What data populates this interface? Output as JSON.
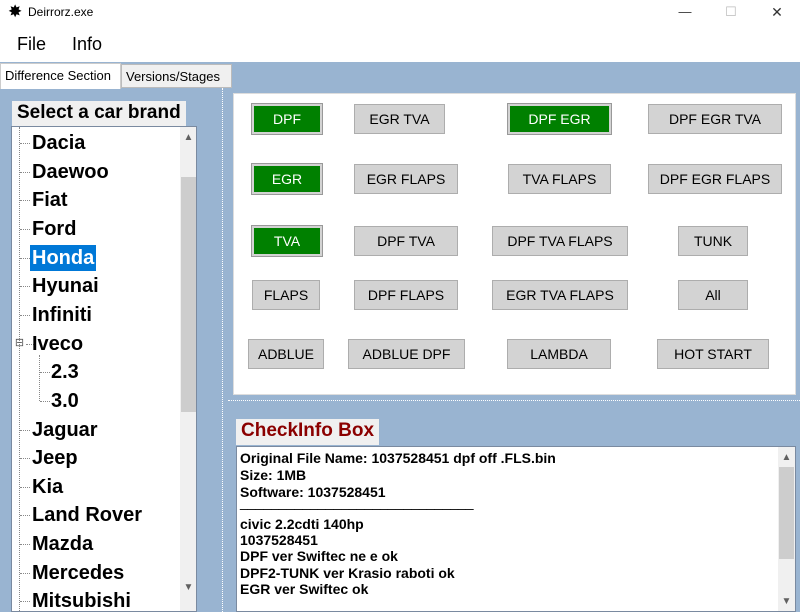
{
  "window": {
    "title": "Deirrorz.exe",
    "minimize_glyph": "—",
    "maximize_glyph": "☐",
    "close_glyph": "✕"
  },
  "menu": {
    "file": "File",
    "info": "Info"
  },
  "tabs": [
    {
      "label": "Difference Section",
      "active": true
    },
    {
      "label": "Versions/Stages",
      "active": false
    }
  ],
  "brand_panel": {
    "label": "Select a car brand",
    "items": [
      "Dacia",
      "Daewoo",
      "Fiat",
      "Ford",
      "Honda",
      "Hyunai",
      "Infiniti",
      "Iveco",
      "2.3",
      "3.0",
      "Jaguar",
      "Jeep",
      "Kia",
      "Land Rover",
      "Mazda",
      "Mercedes",
      "Mitsubishi"
    ],
    "selected": "Honda",
    "expanded": "Iveco"
  },
  "function_buttons": [
    {
      "label": "DPF",
      "active": true
    },
    {
      "label": "EGR TVA",
      "active": false
    },
    {
      "label": "DPF EGR",
      "active": true
    },
    {
      "label": "DPF EGR TVA",
      "active": false
    },
    {
      "label": "EGR",
      "active": true
    },
    {
      "label": "EGR FLAPS",
      "active": false
    },
    {
      "label": "TVA FLAPS",
      "active": false
    },
    {
      "label": "DPF EGR FLAPS",
      "active": false
    },
    {
      "label": "TVA",
      "active": true
    },
    {
      "label": "DPF TVA",
      "active": false
    },
    {
      "label": "DPF TVA FLAPS",
      "active": false
    },
    {
      "label": "TUNK",
      "active": false
    },
    {
      "label": "FLAPS",
      "active": false
    },
    {
      "label": "DPF FLAPS",
      "active": false
    },
    {
      "label": "EGR TVA FLAPS",
      "active": false
    },
    {
      "label": "All",
      "active": false
    },
    {
      "label": "ADBLUE",
      "active": false
    },
    {
      "label": "ADBLUE DPF",
      "active": false
    },
    {
      "label": "LAMBDA",
      "active": false
    },
    {
      "label": "HOT START",
      "active": false
    }
  ],
  "checkinfo": {
    "label": "CheckInfo Box",
    "lines": [
      "Original File Name: 1037528451 dpf off .FLS.bin",
      "Size: 1MB",
      "Software: 1037528451",
      "______________________________",
      "civic 2.2cdti 140hp",
      "1037528451",
      "DPF ver Swiftec ne e ok",
      "DPF2-TUNK ver Krasio raboti ok",
      "EGR ver Swiftec ok"
    ]
  },
  "colors": {
    "app_background": "#99b4d1",
    "active_button": "#008000",
    "inactive_button": "#d3d3d3",
    "selection": "#0078d7",
    "checkinfo_title": "#8b0000"
  }
}
